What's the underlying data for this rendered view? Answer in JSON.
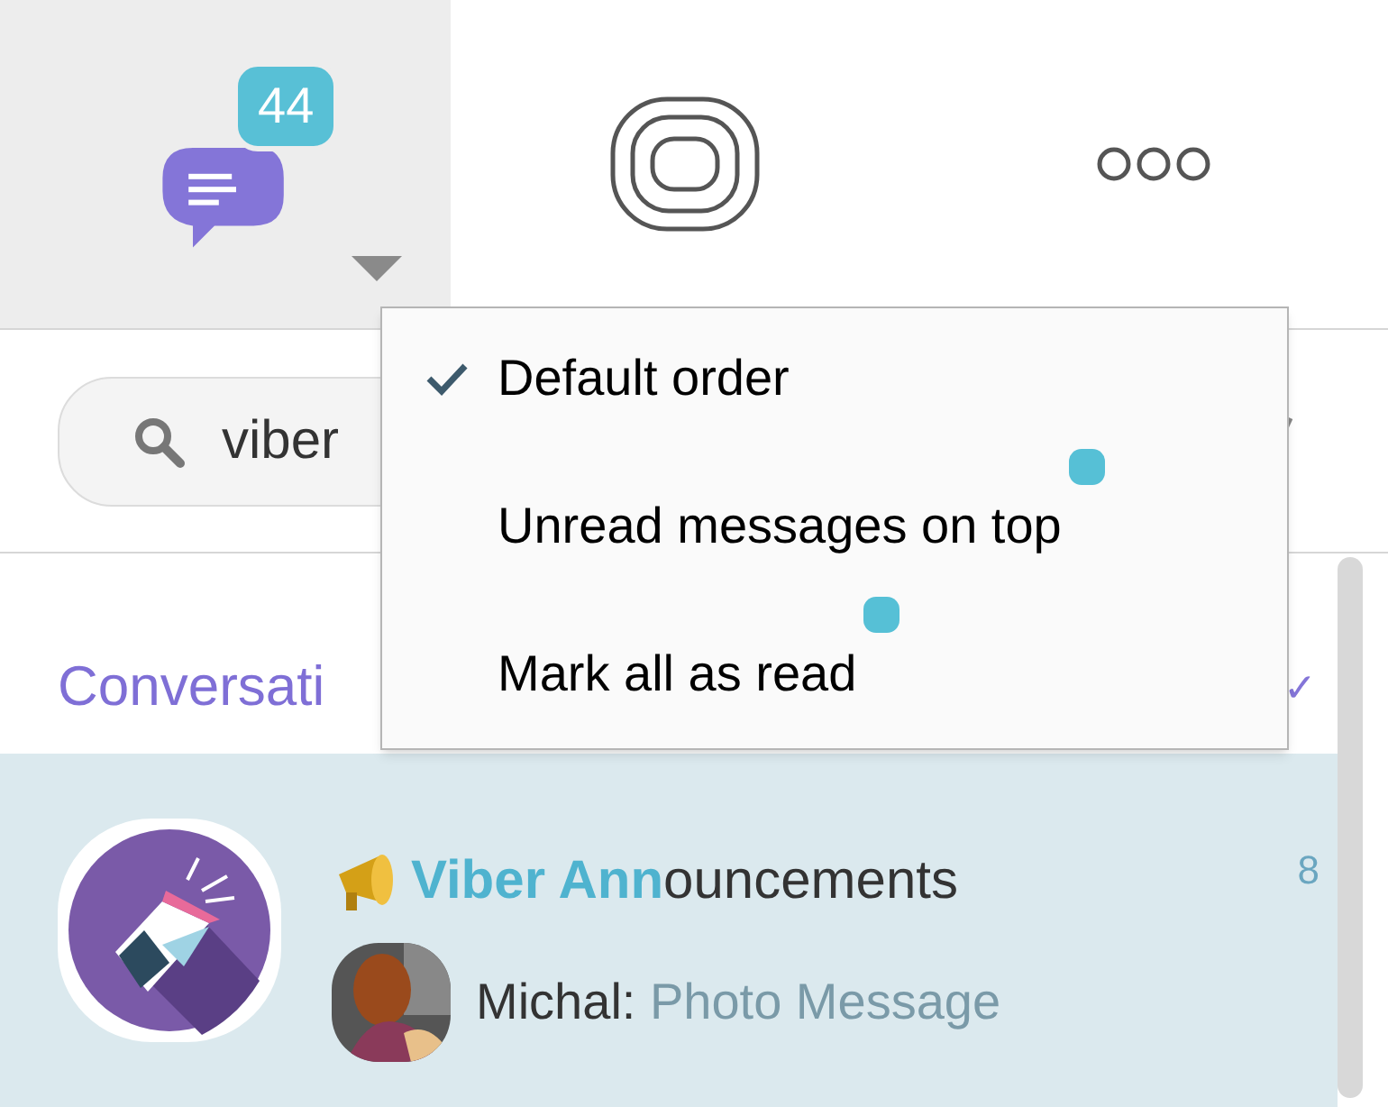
{
  "tabs": [
    {
      "kind": "chats",
      "selected": true,
      "badge": "44"
    },
    {
      "kind": "explore",
      "selected": false
    },
    {
      "kind": "more",
      "selected": false
    }
  ],
  "search": {
    "value": "viber"
  },
  "section": {
    "title": "Conversati",
    "check": "✓"
  },
  "conversation": {
    "title": "**Viber Ann**ouncements",
    "time": "8",
    "sender": "Michal:",
    "message": "Photo Message",
    "selected": true
  },
  "menu": {
    "items": [
      {
        "label": "Default order",
        "selected": true,
        "new": false
      },
      {
        "label": "Unread messages on top",
        "selected": false,
        "new": true
      },
      {
        "label": "Mark all as read",
        "selected": false,
        "new": true
      }
    ]
  }
}
